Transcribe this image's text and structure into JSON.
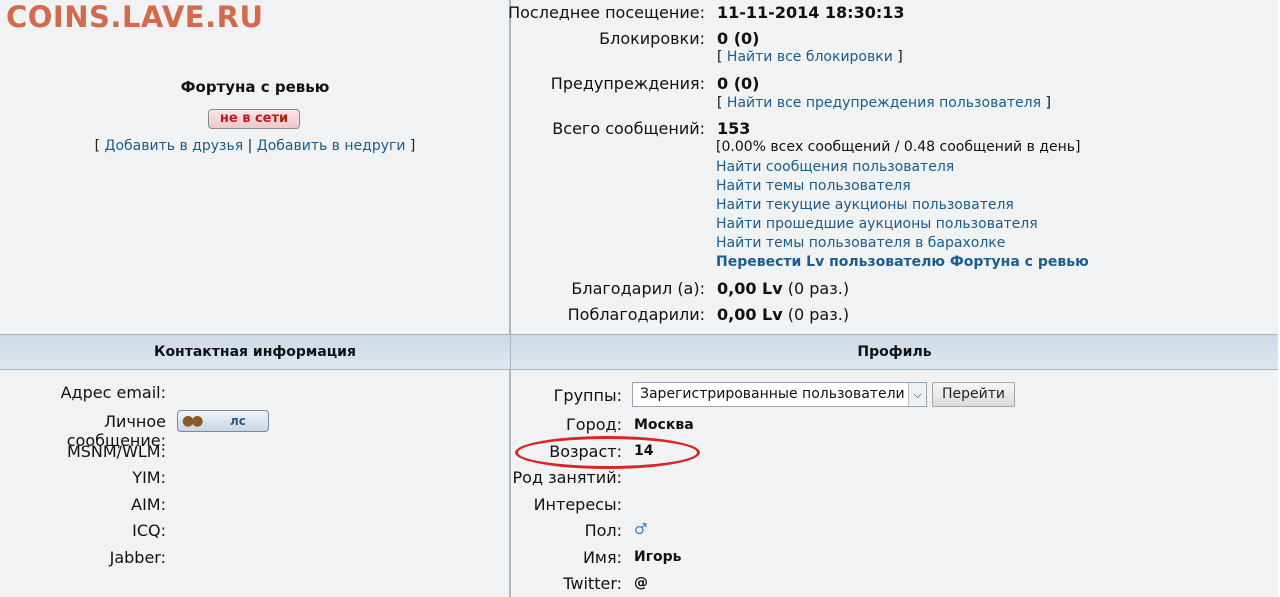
{
  "site": {
    "logo": "COINS.LAVE.RU"
  },
  "user": {
    "name": "Фортуна с ревью",
    "status": "не в сети",
    "friends": {
      "bracket_open": "[",
      "add_friend": "Добавить в друзья",
      "sep": "|",
      "add_foe": "Добавить в недруги",
      "bracket_close": "]"
    }
  },
  "stats": {
    "last_visit": {
      "label": "Последнее посещение:",
      "value": "11-11-2014 18:30:13"
    },
    "bans": {
      "label": "Блокировки:",
      "value": "0 (0)",
      "link": "Найти все блокировки"
    },
    "warnings": {
      "label": "Предупреждения:",
      "value": "0 (0)",
      "link": "Найти все предупреждения пользователя"
    },
    "posts": {
      "label": "Всего сообщений:",
      "value": "153",
      "detail": "[0.00% всех сообщений / 0.48 сообщений в день]",
      "links": [
        "Найти сообщения пользователя",
        "Найти темы пользователя",
        "Найти текущие аукционы пользователя",
        "Найти прошедшие аукционы пользователя",
        "Найти темы пользователя в барахолке"
      ],
      "transfer": "Перевести Lv пользователю Фортуна с ревью"
    },
    "thanked": {
      "label": "Благодарил (а):",
      "value": "0,00 Lv",
      "count": "(0 раз.)"
    },
    "was_thanked": {
      "label": "Поблагодарили:",
      "value": "0,00 Lv",
      "count": "(0 раз.)"
    }
  },
  "contact": {
    "header": "Контактная информация",
    "email": "Адрес email:",
    "pm": "Личное сообщение:",
    "pm_button": "лс",
    "msn": "MSNM/WLM:",
    "yim": "YIM:",
    "aim": "AIM:",
    "icq": "ICQ:",
    "jabber": "Jabber:"
  },
  "profile": {
    "header": "Профиль",
    "groups": {
      "label": "Группы:",
      "selected": "Зарегистрированные пользователи",
      "go": "Перейти"
    },
    "city": {
      "label": "Город:",
      "value": "Москва"
    },
    "age": {
      "label": "Возраст:",
      "value": "14"
    },
    "occupation": {
      "label": "Род занятий:"
    },
    "interests": {
      "label": "Интересы:"
    },
    "gender": {
      "label": "Пол:",
      "icon": "male-icon"
    },
    "name": {
      "label": "Имя:",
      "value": "Игорь"
    },
    "twitter": {
      "label": "Twitter:",
      "value": "@"
    }
  },
  "colors": {
    "logo": "#d26a4e",
    "link": "#1a5c8e",
    "highlight_ellipse": "#d42727",
    "header_bg": "#d6e0e9"
  }
}
